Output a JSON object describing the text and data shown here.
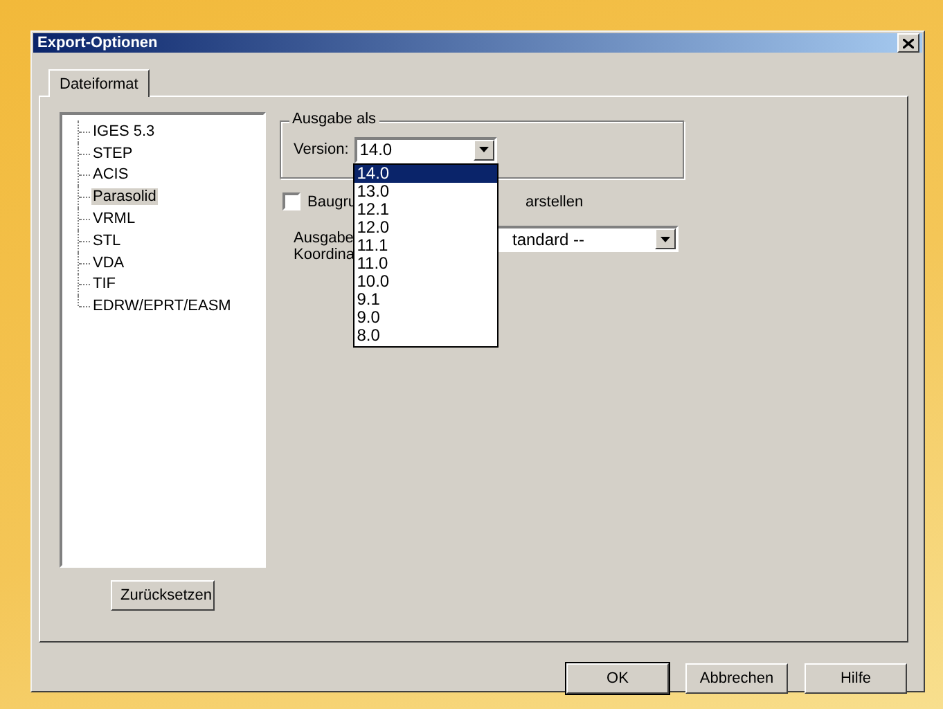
{
  "window": {
    "title": "Export-Optionen"
  },
  "tabs": [
    {
      "label": "Dateiformat",
      "selected": true
    }
  ],
  "formats": [
    {
      "label": "IGES 5.3",
      "selected": false
    },
    {
      "label": "STEP",
      "selected": false
    },
    {
      "label": "ACIS",
      "selected": false
    },
    {
      "label": "Parasolid",
      "selected": true
    },
    {
      "label": "VRML",
      "selected": false
    },
    {
      "label": "STL",
      "selected": false
    },
    {
      "label": "VDA",
      "selected": false
    },
    {
      "label": "TIF",
      "selected": false
    },
    {
      "label": "EDRW/EPRT/EASM",
      "selected": false
    }
  ],
  "reset_button": "Zurücksetzen",
  "output_group": {
    "title": "Ausgabe als",
    "version_label": "Version:",
    "version_value": "14.0",
    "version_options": [
      {
        "label": "14.0",
        "selected": true
      },
      {
        "label": "13.0",
        "selected": false
      },
      {
        "label": "12.1",
        "selected": false
      },
      {
        "label": "12.0",
        "selected": false
      },
      {
        "label": "11.1",
        "selected": false
      },
      {
        "label": "11.0",
        "selected": false
      },
      {
        "label": "10.0",
        "selected": false
      },
      {
        "label": "9.1",
        "selected": false
      },
      {
        "label": "9.0",
        "selected": false
      },
      {
        "label": "8.0",
        "selected": false
      }
    ]
  },
  "assembly_checkbox": {
    "label_start": "Baugru",
    "label_end": "arstellen",
    "checked": false
  },
  "coordinate_label": [
    "Ausgabe",
    "Koordina"
  ],
  "coordinate_value": "tandard --",
  "buttons": [
    {
      "label": "OK",
      "default": true
    },
    {
      "label": "Abbrechen",
      "default": false
    },
    {
      "label": "Hilfe",
      "default": false
    }
  ]
}
